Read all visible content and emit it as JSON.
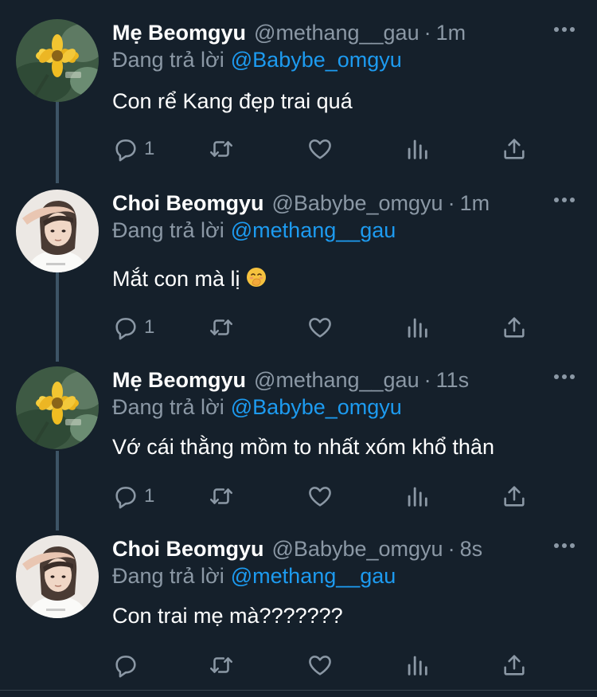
{
  "tweets": [
    {
      "name": "Mẹ Beomgyu",
      "handle": "@methang__gau",
      "time": "1m",
      "reply_label": "Đang trả lời",
      "reply_to": "@Babybe_omgyu",
      "text": "Con rể Kang đẹp trai quá",
      "reply_count": "1",
      "avatar": "flower-avatar"
    },
    {
      "name": "Choi Beomgyu",
      "handle": "@Babybe_omgyu",
      "time": "1m",
      "reply_label": "Đang trả lời",
      "reply_to": "@methang__gau",
      "text": "Mắt con mà lị",
      "emoji": "hand-over-mouth-emoji",
      "reply_count": "1",
      "avatar": "person-avatar"
    },
    {
      "name": "Mẹ Beomgyu",
      "handle": "@methang__gau",
      "time": "11s",
      "reply_label": "Đang trả lời",
      "reply_to": "@Babybe_omgyu",
      "text": "Vớ cái thằng mồm to nhất xóm khổ thân",
      "reply_count": "1",
      "avatar": "flower-avatar"
    },
    {
      "name": "Choi Beomgyu",
      "handle": "@Babybe_omgyu",
      "time": "8s",
      "reply_label": "Đang trả lời",
      "reply_to": "@methang__gau",
      "text": "Con trai mẹ mà???????",
      "reply_count": "",
      "avatar": "person-avatar"
    }
  ],
  "separator": "·",
  "colors": {
    "background": "#15202b",
    "secondary_text": "#8b98a5",
    "mention": "#1d9bf0",
    "thread_line": "#3d5466"
  }
}
